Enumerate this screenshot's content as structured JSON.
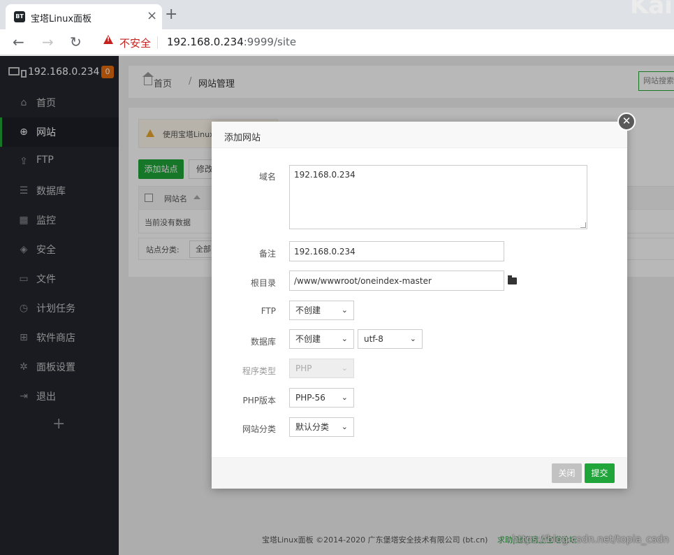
{
  "browser": {
    "tab_title": "宝塔Linux面板",
    "favicon_text": "BT",
    "tab_close": "×",
    "new_tab": "+",
    "insecure_label": "不安全",
    "url_host": "192.168.0.234",
    "url_rest": ":9999/site",
    "corner_text": "Kai"
  },
  "sidebar": {
    "host": "192.168.0.234",
    "badge": "0",
    "items": [
      {
        "label": "首页",
        "icon": "home-icon",
        "glyph": "⌂"
      },
      {
        "label": "网站",
        "icon": "globe-icon",
        "glyph": "⊕"
      },
      {
        "label": "FTP",
        "icon": "ftp-icon",
        "glyph": "⇪"
      },
      {
        "label": "数据库",
        "icon": "database-icon",
        "glyph": "☰"
      },
      {
        "label": "监控",
        "icon": "monitor-icon",
        "glyph": "▦"
      },
      {
        "label": "安全",
        "icon": "shield-icon",
        "glyph": "◈"
      },
      {
        "label": "文件",
        "icon": "folder-icon",
        "glyph": "▭"
      },
      {
        "label": "计划任务",
        "icon": "clock-icon",
        "glyph": "◷"
      },
      {
        "label": "软件商店",
        "icon": "apps-icon",
        "glyph": "⊞"
      },
      {
        "label": "面板设置",
        "icon": "gear-icon",
        "glyph": "✲"
      },
      {
        "label": "退出",
        "icon": "logout-icon",
        "glyph": "⇥"
      }
    ],
    "add": "+"
  },
  "main": {
    "breadcrumb": {
      "home": "首页",
      "separator": "/",
      "current": "网站管理"
    },
    "site_search_placeholder": "网站搜索",
    "notice": "使用宝塔Linux",
    "add_site_button": "添加站点",
    "modify_button": "修改",
    "table_header_name": "网站名",
    "table_empty": "当前没有数据",
    "category_label": "站点分类:",
    "category_value": "全部"
  },
  "footer": {
    "copyright": "宝塔Linux面板 ©2014-2020 广东堡塔安全技术有限公司 (bt.cn)",
    "link": "求助|建议请上宝塔论坛",
    "watermark": "https://blog.csdn.net/topia_csdn"
  },
  "modal": {
    "title": "添加网站",
    "close_glyph": "✕",
    "fields": {
      "domain": {
        "label": "域名",
        "value": "192.168.0.234"
      },
      "remark": {
        "label": "备注",
        "value": "192.168.0.234"
      },
      "root": {
        "label": "根目录",
        "value": "/www/wwwroot/oneindex-master"
      },
      "ftp": {
        "label": "FTP",
        "value": "不创建"
      },
      "database": {
        "label": "数据库",
        "value": "不创建",
        "charset": "utf-8"
      },
      "program_type": {
        "label": "程序类型",
        "value": "PHP"
      },
      "php_version": {
        "label": "PHP版本",
        "value": "PHP-56"
      },
      "category": {
        "label": "网站分类",
        "value": "默认分类"
      }
    },
    "cancel_button": "关闭",
    "submit_button": "提交"
  },
  "colors": {
    "accent": "#20a53a",
    "sidebar_bg": "#23262e",
    "badge": "#e56d0d",
    "insecure": "#c5221f"
  }
}
